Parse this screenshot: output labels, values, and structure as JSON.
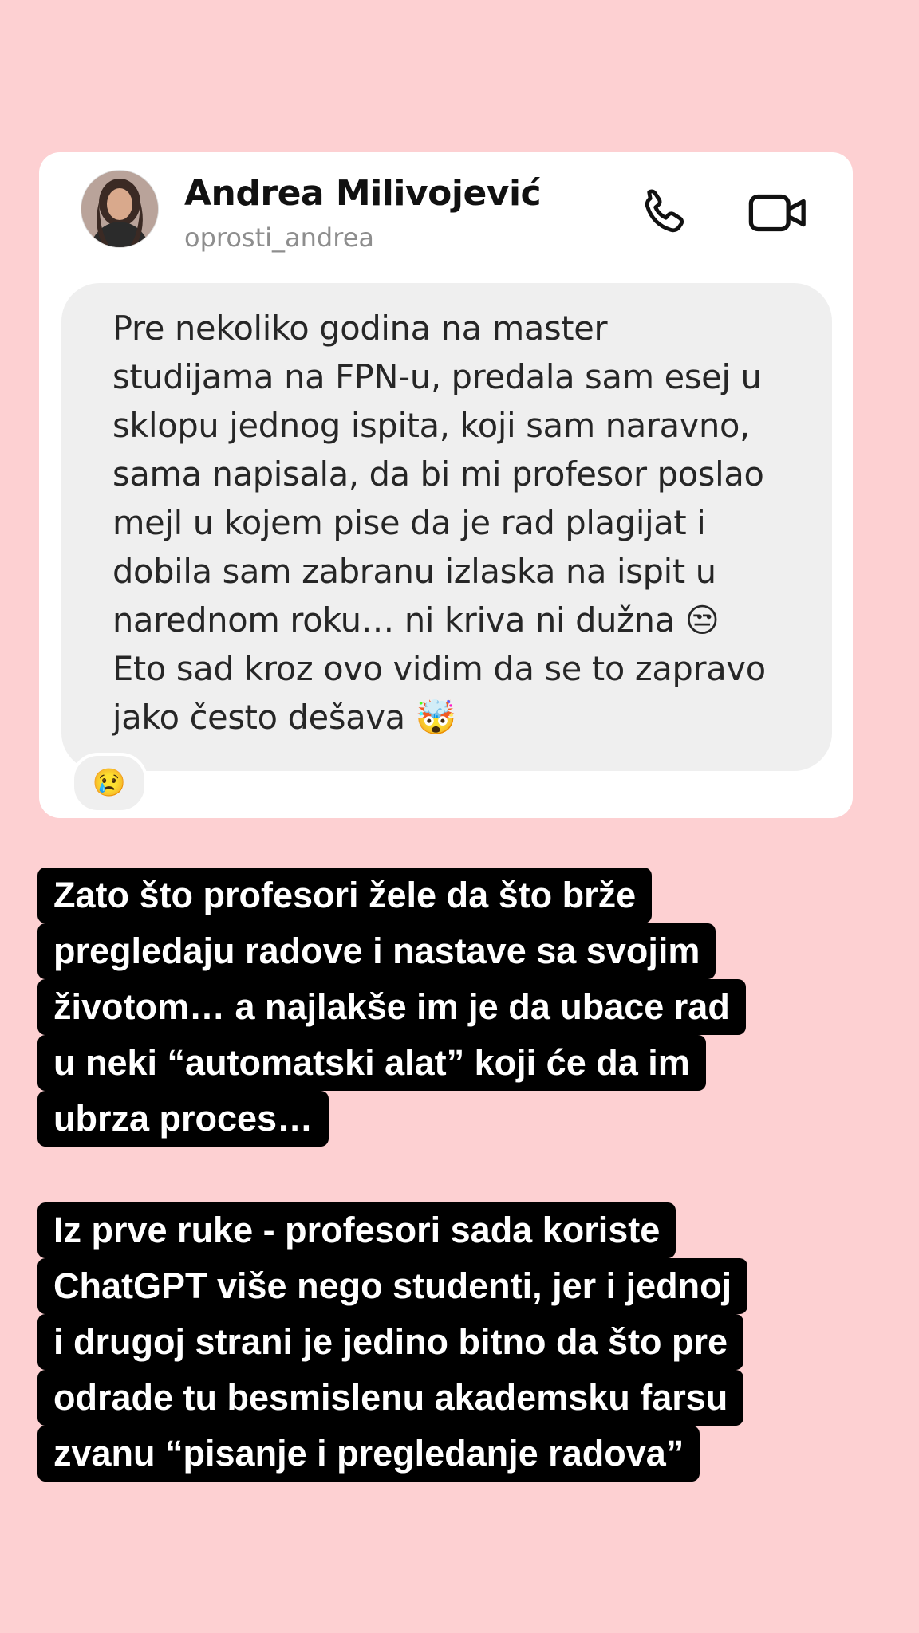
{
  "dm_card": {
    "user": {
      "name": "Andrea Milivojević",
      "handle": "oprosti_andrea"
    },
    "icons": {
      "call": "phone-icon",
      "video": "video-camera-icon"
    },
    "message": {
      "lines": [
        "Pre nekoliko godina na master",
        "studijama na FPN-u, predala sam esej u",
        "sklopu jednog ispita, koji sam naravno,",
        "sama napisala, da bi mi profesor poslao",
        "mejl u kojem pise da je rad plagijat i",
        "dobila sam zabranu izlaska na ispit u",
        "narednom roku… ni kriva ni dužna 😒",
        "Eto sad kroz ovo vidim da se to zapravo",
        "jako često dešava 🤯"
      ]
    },
    "reaction": "😢"
  },
  "captions": [
    {
      "lines": [
        "Zato što profesori žele da što brže",
        "pregledaju radove i nastave sa svojim",
        "životom… a najlakše im je da ubace rad",
        "u neki “automatski alat” koji će da im",
        "ubrza proces…"
      ]
    },
    {
      "lines": [
        "Iz prve ruke - profesori sada koriste",
        "ChatGPT više nego studenti, jer i jednoj",
        "i drugoj strani je jedino bitno da što pre",
        "odrade tu besmislenu akademsku farsu",
        "zvanu “pisanje i pregledanje radova”"
      ]
    }
  ]
}
